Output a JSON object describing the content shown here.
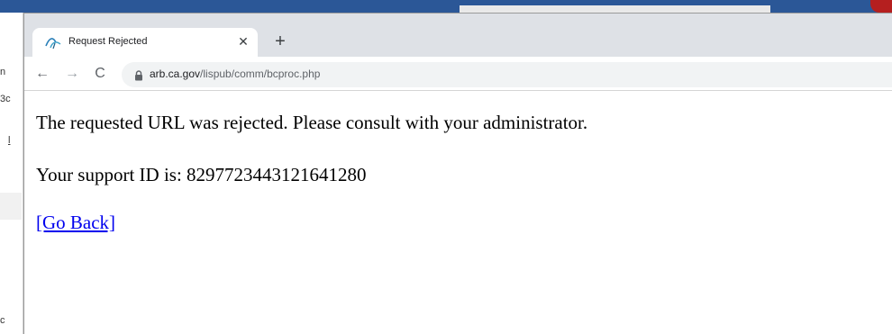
{
  "background": {
    "left_fragments": [
      "n",
      "3c",
      "l",
      "c"
    ]
  },
  "tab": {
    "title": "Request Rejected",
    "close_glyph": "✕",
    "favicon": "ca-arb-icon"
  },
  "new_tab_glyph": "+",
  "nav": {
    "back_glyph": "←",
    "forward_glyph": "→",
    "reload_glyph": "C"
  },
  "address_bar": {
    "lock_icon": "lock-icon",
    "domain": "arb.ca.gov",
    "path": "/lispub/comm/bcproc.php"
  },
  "page": {
    "message": "The requested URL was rejected. Please consult with your administrator.",
    "support_id_text": "Your support ID is: 8297723443121641280",
    "go_back_link": "[Go Back]"
  },
  "colors": {
    "link": "#0000ee",
    "tabstrip": "#dee1e6",
    "omnibox": "#f1f3f4",
    "desktop_bar": "#2b5797"
  }
}
